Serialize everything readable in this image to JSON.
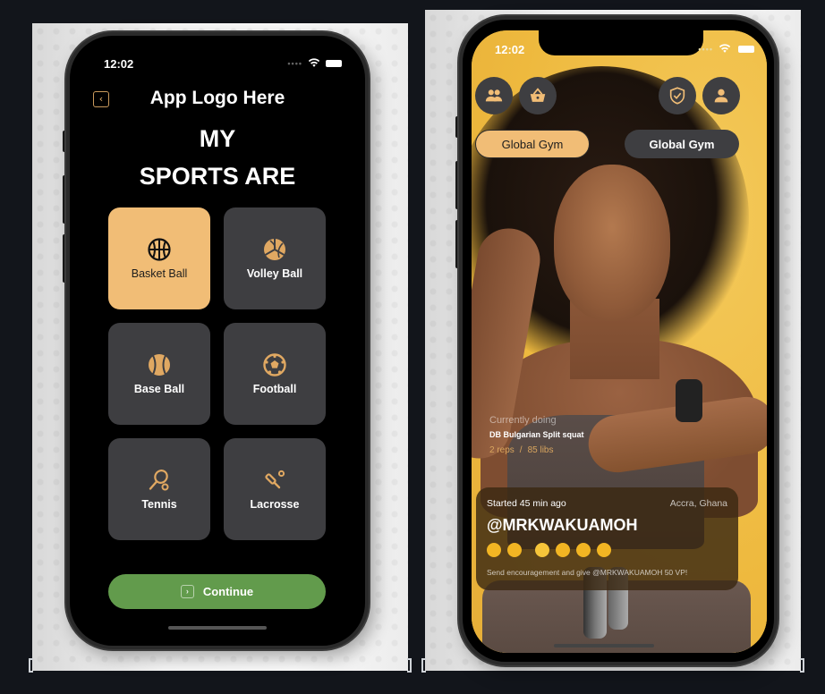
{
  "left_screen": {
    "status_time": "12:02",
    "back_icon": "chevron-left-icon",
    "app_logo": "App Logo Here",
    "headline_line1": "MY",
    "headline_line2": "SPORTS ARE",
    "sports": [
      {
        "label": "Basket Ball",
        "icon": "basketball-icon",
        "selected": true
      },
      {
        "label": "Volley Ball",
        "icon": "volleyball-icon",
        "selected": false
      },
      {
        "label": "Base Ball",
        "icon": "baseball-icon",
        "selected": false
      },
      {
        "label": "Football",
        "icon": "soccer-ball-icon",
        "selected": false
      },
      {
        "label": "Tennis",
        "icon": "tennis-racket-icon",
        "selected": false
      },
      {
        "label": "Lacrosse",
        "icon": "lacrosse-stick-icon",
        "selected": false
      }
    ],
    "continue_label": "Continue",
    "continue_icon": "chevron-right-icon"
  },
  "right_screen": {
    "status_time": "12:02",
    "top_buttons": [
      {
        "icon": "users-icon"
      },
      {
        "icon": "basket-icon"
      },
      {
        "icon": "shield-check-icon"
      },
      {
        "icon": "user-icon"
      }
    ],
    "gym_pills": [
      {
        "label": "Global Gym",
        "active": true
      },
      {
        "label": "Global Gym",
        "active": false
      }
    ],
    "currently_doing": {
      "label": "Currently doing",
      "exercise": "DB Bulgarian Split squat",
      "reps": "2 reps",
      "weight": "85 libs"
    },
    "activity": {
      "started": "Started 45 min ago",
      "location": "Accra, Ghana",
      "handle": "@MRKWAKUAMOH",
      "emojis": [
        "🙌",
        "👊",
        "😤",
        "💪",
        "💪",
        "💪"
      ],
      "cta": "Send encouragement and  give @MRKWAKUAMOH 50 VP!"
    }
  },
  "colors": {
    "accent_orange": "#f1bd76",
    "card_dark": "#3e3e41",
    "continue_green": "#629b4c",
    "photo_yellow": "#f0be4a"
  }
}
